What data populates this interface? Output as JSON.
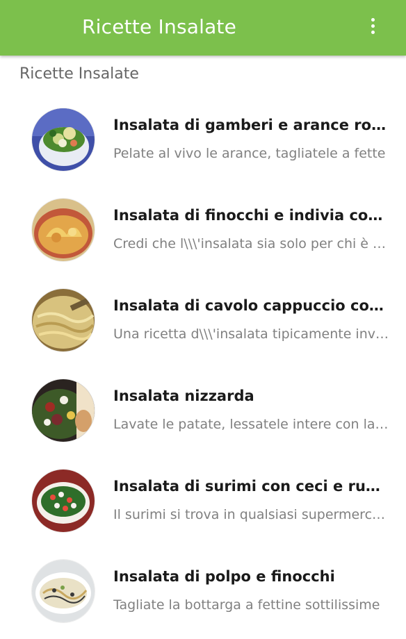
{
  "appbar": {
    "title": "Ricette Insalate",
    "background": "#7cc04c",
    "menu_icon": "overflow-vertical-icon"
  },
  "section": {
    "title": "Ricette Insalate"
  },
  "recipes": [
    {
      "title": "Insalata di gamberi e arance rosse",
      "description": "Pelate al vivo le arance, tagliatele a fette",
      "thumbnail": "salad-bowl-thumbnail"
    },
    {
      "title": "Insalata di finocchi e indivia con arance",
      "description": "Credi che l\\\\\\'insalata sia solo per chi è a dieta",
      "thumbnail": "fennel-salad-thumbnail"
    },
    {
      "title": "Insalata di cavolo cappuccio con mele",
      "description": "Una ricetta d\\\\\\'insalata tipicamente invernale",
      "thumbnail": "cabbage-salad-thumbnail"
    },
    {
      "title": "Insalata nizzarda",
      "description": "Lavate le patate, lessatele intere con la buccia",
      "thumbnail": "nicoise-salad-thumbnail"
    },
    {
      "title": "Insalata di surimi con ceci e rucola",
      "description": "Il surimi si trova in qualsiasi supermercato",
      "thumbnail": "surimi-salad-thumbnail"
    },
    {
      "title": "Insalata di polpo e finocchi",
      "description": "Tagliate la bottarga a fettine sottilissime",
      "thumbnail": "octopus-salad-thumbnail"
    }
  ]
}
